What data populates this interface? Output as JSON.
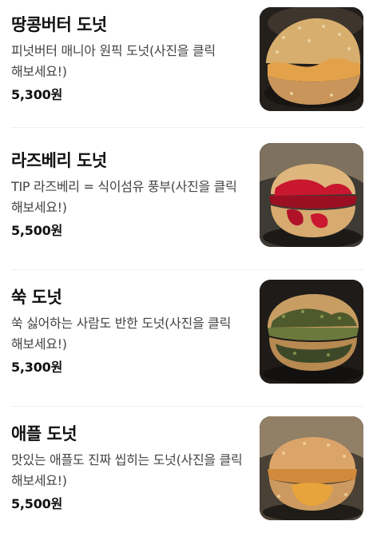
{
  "items": [
    {
      "name": "땅콩버터 도넛",
      "description": "피넛버터 매니아 원픽 도넛(사진을 클릭 해보세요!)",
      "price": "5,300원",
      "image": "peanut-butter-donut-photo",
      "filling_color": "#e3a24a"
    },
    {
      "name": "라즈베리 도넛",
      "description": "TIP 라즈베리 = 식이섬유 풍부(사진을 클릭 해보세요!)",
      "price": "5,500원",
      "image": "raspberry-donut-photo",
      "filling_color": "#c8172e"
    },
    {
      "name": "쑥 도넛",
      "description": "쑥 싫어하는 사람도 반한 도넛(사진을 클릭 해보세요!)",
      "price": "5,300원",
      "image": "mugwort-donut-photo",
      "filling_color": "#4e5a2c"
    },
    {
      "name": "애플 도넛",
      "description": "맛있는 애플도 진짜 씹히는 도넛(사진을 클릭 해보세요!)",
      "price": "5,500원",
      "image": "apple-donut-photo",
      "filling_color": "#e8a33a"
    }
  ]
}
